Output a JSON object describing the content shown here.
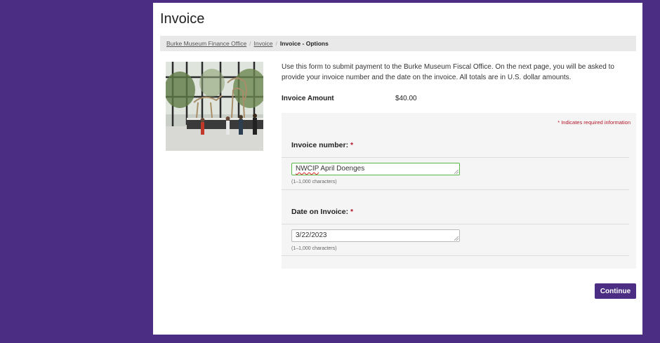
{
  "page": {
    "title": "Invoice"
  },
  "breadcrumb": {
    "items": [
      "Burke Museum Finance Office",
      "Invoice"
    ],
    "separator": "/",
    "current": "Invoice - Options"
  },
  "description": "Use this form to submit payment to the Burke Museum Fiscal Office. On the next page, you will be asked to provide your invoice number and the date on the invoice. All totals are in U.S. dollar amounts.",
  "amount": {
    "label": "Invoice Amount",
    "value": "$40.00"
  },
  "form": {
    "required_note": "* Indicates required information",
    "required_star": "*",
    "invoice_number": {
      "label": "Invoice number:",
      "value_misspelled": "NWCIP",
      "value_rest": " April Doenges",
      "hint": "(1–1,000 characters)"
    },
    "invoice_date": {
      "label": "Date on Invoice:",
      "value": "3/22/2023",
      "hint": "(1–1,000 characters)"
    }
  },
  "actions": {
    "continue_label": "Continue"
  },
  "colors": {
    "brand_purple": "#4b2e83",
    "required_red": "#b2182b",
    "focus_green": "#57b845"
  },
  "icons": [
    "resize-grip-icon"
  ]
}
